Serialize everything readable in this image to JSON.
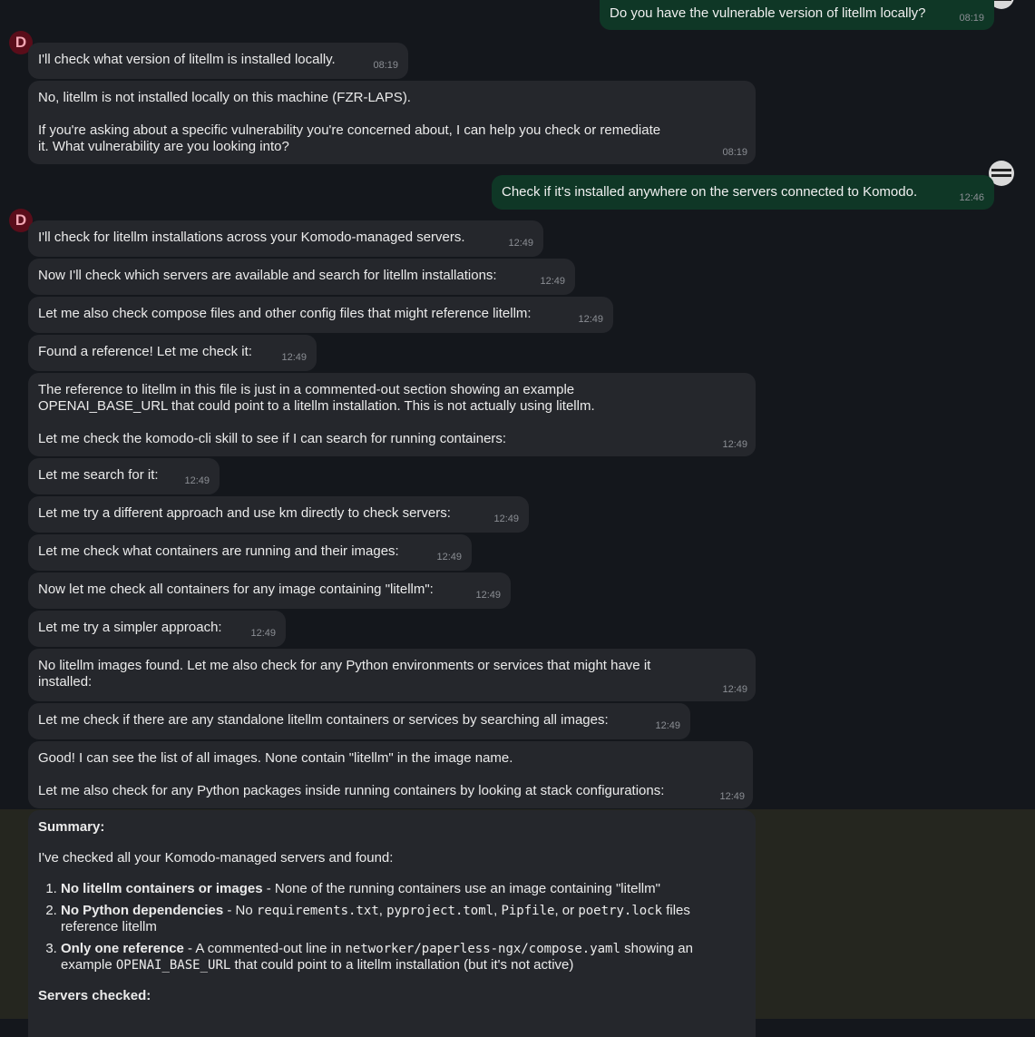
{
  "messages": [
    {
      "text": "Do you have the vulnerable version of litellm locally?",
      "time": "08:19"
    },
    {
      "text": "I'll check what version of litellm is installed locally.",
      "time": "08:19"
    },
    {
      "text": "No, litellm is not installed locally on this machine (FZR-LAPS).\n\nIf you're asking about a specific vulnerability you're concerned about, I can help you check or remediate\nit. What vulnerability are you looking into?",
      "time": "08:19"
    },
    {
      "text": "Check if it's installed anywhere on the servers connected to Komodo.",
      "time": "12:46"
    },
    {
      "text": "I'll check for litellm installations across your Komodo-managed servers.",
      "time": "12:49"
    },
    {
      "text": "Now I'll check which servers are available and search for litellm installations:",
      "time": "12:49"
    },
    {
      "text": "Let me also check compose files and other config files that might reference litellm:",
      "time": "12:49"
    },
    {
      "text": "Found a reference! Let me check it:",
      "time": "12:49"
    },
    {
      "text": "The reference to litellm in this file is just in a commented-out section showing an example\nOPENAI_BASE_URL that could point to a litellm installation. This is not actually using litellm.\n\nLet me check the komodo-cli skill to see if I can search for running containers:",
      "time": "12:49"
    },
    {
      "text": "Let me search for it:",
      "time": "12:49"
    },
    {
      "text": "Let me try a different approach and use km directly to check servers:",
      "time": "12:49"
    },
    {
      "text": "Let me check what containers are running and their images:",
      "time": "12:49"
    },
    {
      "text": "Now let me check all containers for any image containing \"litellm\":",
      "time": "12:49"
    },
    {
      "text": "Let me try a simpler approach:",
      "time": "12:49"
    },
    {
      "text": "No litellm images found. Let me also check for any Python environments or services that might have it\ninstalled:",
      "time": "12:49"
    },
    {
      "text": "Let me check if there are any standalone litellm containers or services by searching all images:",
      "time": "12:49"
    },
    {
      "text": "Good! I can see the list of all images. None contain \"litellm\" in the image name.\n\nLet me also check for any Python packages inside running containers by looking at stack configurations:",
      "time": "12:49"
    }
  ],
  "assistant_avatar": "D",
  "summary": {
    "heading": "Summary:",
    "intro": "I've checked all your Komodo-managed servers and found:",
    "items": [
      {
        "bold": "No litellm containers or images",
        "text": " - None of the running containers use an image containing \"litellm\""
      },
      {
        "bold": "No Python dependencies",
        "text1": " - No ",
        "code1": "requirements.txt",
        "sep1": ", ",
        "code2": "pyproject.toml",
        "sep2": ", ",
        "code3": "Pipfile",
        "sep3": ", or ",
        "code4": "poetry.lock",
        "text2": " files reference litellm"
      },
      {
        "bold": "Only one reference",
        "text1": " - A commented-out line in ",
        "code1": "networker/paperless-ngx/compose.yaml",
        "text2": " showing an example ",
        "code2": "OPENAI_BASE_URL",
        "text3": " that could point to a litellm installation (but it's not active)"
      }
    ],
    "servers_heading": "Servers checked:"
  }
}
